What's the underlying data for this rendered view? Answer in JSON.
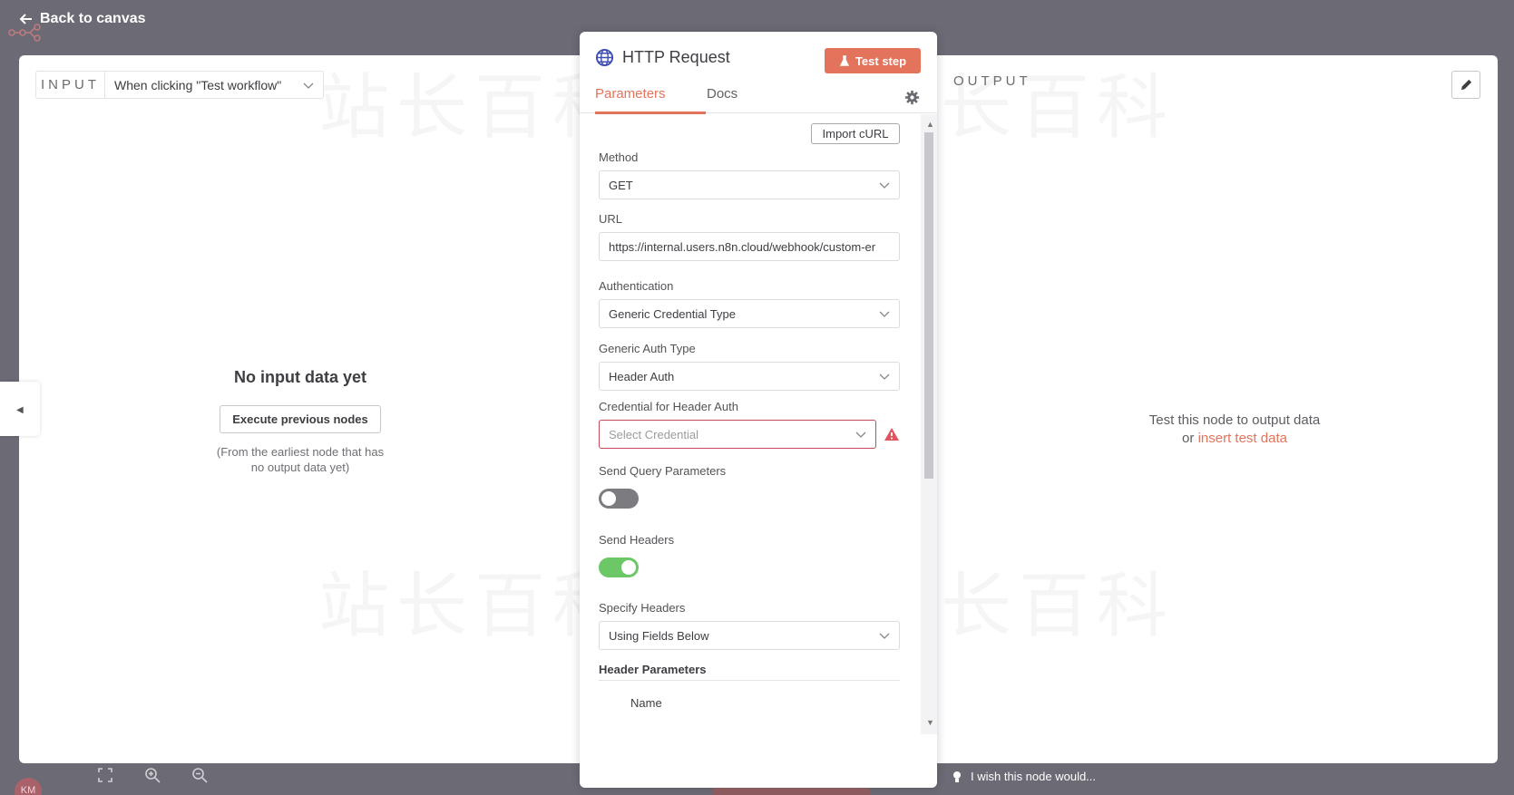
{
  "topbar": {
    "back_label": "Back to canvas"
  },
  "input_pane": {
    "label": "INPUT",
    "trigger_select": "When clicking \"Test workflow\"",
    "empty_title": "No input data yet",
    "execute_label": "Execute previous nodes",
    "hint": "(From the earliest node that has no output data yet)"
  },
  "output_pane": {
    "label": "OUTPUT",
    "empty_line1": "Test this node to output data",
    "empty_or": "or",
    "insert_link": "insert test data"
  },
  "node_panel": {
    "title": "HTTP Request",
    "test_label": "Test step",
    "tabs": [
      {
        "label": "Parameters",
        "active": true
      },
      {
        "label": "Docs",
        "active": false
      }
    ],
    "import_label": "Import cURL",
    "fields": {
      "method": {
        "label": "Method",
        "value": "GET"
      },
      "url": {
        "label": "URL",
        "value": "https://internal.users.n8n.cloud/webhook/custom-er"
      },
      "auth": {
        "label": "Authentication",
        "value": "Generic Credential Type"
      },
      "generic_auth": {
        "label": "Generic Auth Type",
        "value": "Header Auth"
      },
      "credential": {
        "label": "Credential for Header Auth",
        "placeholder": "Select Credential"
      },
      "send_query": {
        "label": "Send Query Parameters",
        "on": false
      },
      "send_headers": {
        "label": "Send Headers",
        "on": true
      },
      "specify_headers": {
        "label": "Specify Headers",
        "value": "Using Fields Below"
      }
    },
    "header_params_title": "Header Parameters",
    "header_name_label": "Name"
  },
  "bottom": {
    "avatar_initials": "KM",
    "wish_label": "I wish this node would..."
  },
  "colors": {
    "accent": "#e4735b",
    "toggle_on": "#6cc766",
    "toggle_off": "#7b7b80",
    "error": "#c24a5b",
    "backdrop": "#6c6a74"
  },
  "icons": [
    "arrow-left-icon",
    "globe-icon",
    "flask-icon",
    "gear-icon",
    "pencil-icon",
    "warning-icon",
    "chevron-down-icon",
    "fullscreen-icon",
    "zoom-in-icon",
    "zoom-out-icon",
    "lightbulb-icon"
  ]
}
